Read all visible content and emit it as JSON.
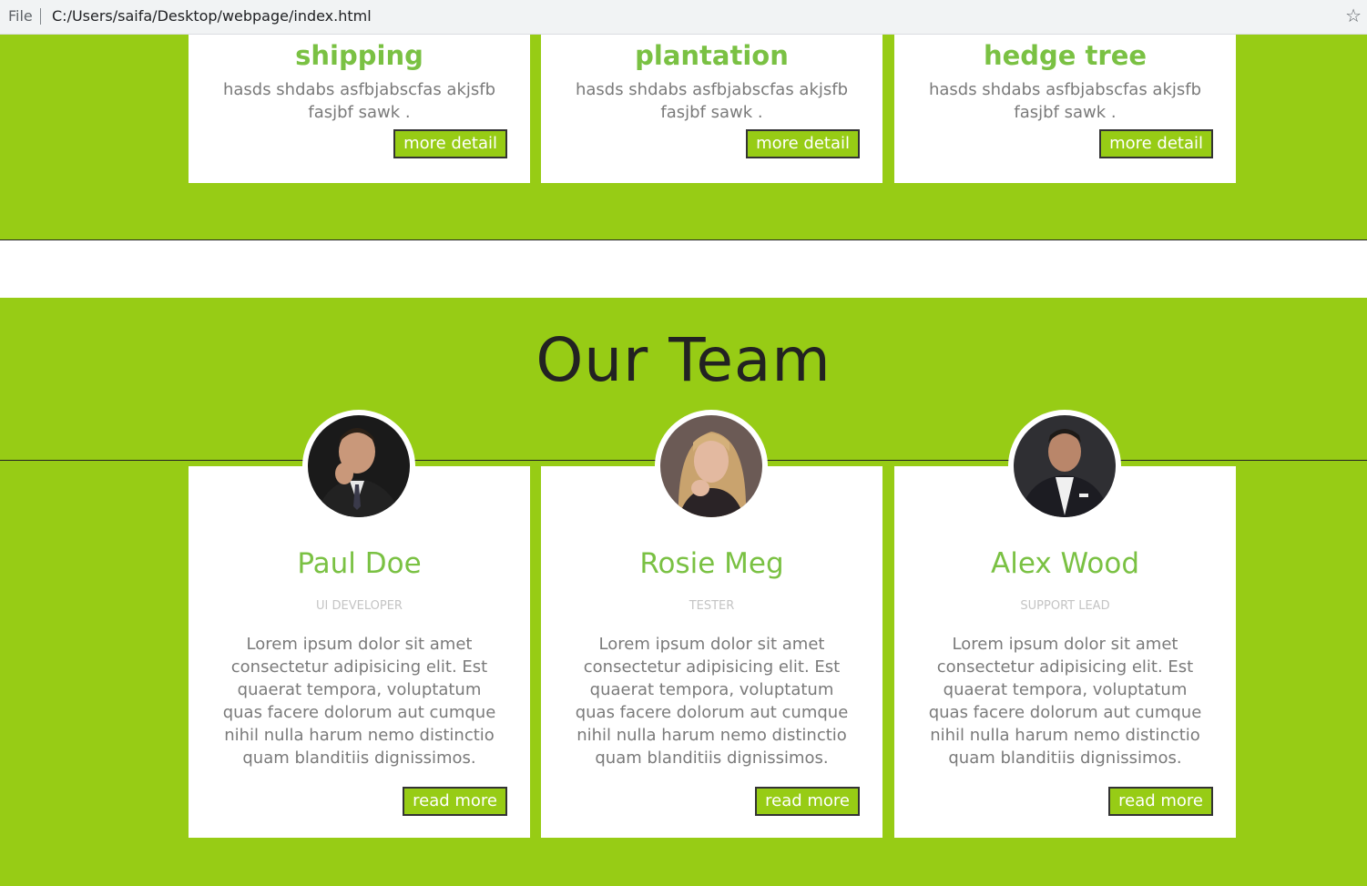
{
  "browser": {
    "file_label": "File",
    "url": "C:/Users/saifa/Desktop/webpage/index.html",
    "bookmark_icon": "star-icon"
  },
  "services": {
    "cards": [
      {
        "title": "shipping",
        "text": "hasds shdabs asfbjabscfas akjsfb fasjbf sawk .",
        "button": "more detail"
      },
      {
        "title": "plantation",
        "text": "hasds shdabs asfbjabscfas akjsfb fasjbf sawk .",
        "button": "more detail"
      },
      {
        "title": "hedge tree",
        "text": "hasds shdabs asfbjabscfas akjsfb fasjbf sawk .",
        "button": "more detail"
      }
    ]
  },
  "team": {
    "heading": "Our Team",
    "members": [
      {
        "name": "Paul Doe",
        "role": "UI DEVELOPER",
        "bio": "Lorem ipsum dolor sit amet consectetur adipisicing elit. Est quaerat tempora, voluptatum quas facere dolorum aut cumque nihil nulla harum nemo distinctio quam blanditiis dignissimos.",
        "button": "read more"
      },
      {
        "name": "Rosie Meg",
        "role": "TESTER",
        "bio": "Lorem ipsum dolor sit amet consectetur adipisicing elit. Est quaerat tempora, voluptatum quas facere dolorum aut cumque nihil nulla harum nemo distinctio quam blanditiis dignissimos.",
        "button": "read more"
      },
      {
        "name": "Alex Wood",
        "role": "SUPPORT LEAD",
        "bio": "Lorem ipsum dolor sit amet consectetur adipisicing elit. Est quaerat tempora, voluptatum quas facere dolorum aut cumque nihil nulla harum nemo distinctio quam blanditiis dignissimos.",
        "button": "read more"
      }
    ]
  },
  "colors": {
    "accent_green": "#97cc15",
    "title_green": "#7ac143",
    "body_text": "#7a7a7a"
  }
}
